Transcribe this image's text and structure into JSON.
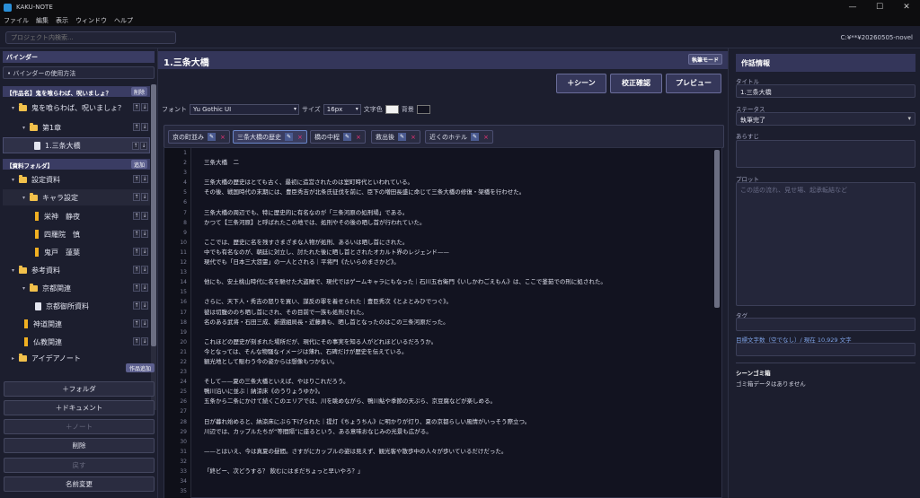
{
  "window": {
    "title": "KAKU-NOTE",
    "buttons": [
      "—",
      "☐",
      "✕"
    ]
  },
  "menu": [
    "ファイル",
    "編集",
    "表示",
    "ウィンドウ",
    "ヘルプ"
  ],
  "project_search": {
    "placeholder": "プロジェクト内検索..."
  },
  "project_path": "C:¥**¥20260505-novel",
  "binder": {
    "header": "バインダー",
    "usage": "• バインダーの使用方法",
    "works_section": {
      "title": "【作品名】鬼を喰らわば、呪いましょ？",
      "button": "削除"
    },
    "materials_section": {
      "title": "【資料フォルダ】",
      "button": "追加"
    },
    "rows": [
      {
        "text": "鬼を喰らわば、呪いましょ？"
      },
      {
        "text": "第1章"
      },
      {
        "text": "1.三条大橋"
      },
      {
        "text": "設定資料"
      },
      {
        "text": "キャラ設定"
      },
      {
        "text": "栄神　静夜"
      },
      {
        "text": "四羅院　慎"
      },
      {
        "text": "鬼戸　蓮葉"
      },
      {
        "text": "参考資料"
      },
      {
        "text": "京都関連"
      },
      {
        "text": "京都御所資料"
      },
      {
        "text": "神道関連"
      },
      {
        "text": "仏教関連"
      },
      {
        "text": "アイデアノート"
      }
    ],
    "add_work": "作品追加",
    "buttons": {
      "folder": "＋フォルダ",
      "document": "＋ドキュメント",
      "note": "＋ノート",
      "delete": "削除",
      "back": "戻す",
      "rename": "名前変更"
    }
  },
  "editor": {
    "title": "1.三条大橋",
    "mode_button": "執筆モード",
    "add_scene": "＋シーン",
    "proofread": "校正確認",
    "preview": "プレビュー",
    "font_label": "フォント",
    "font_value": "Yu Gothic UI",
    "size_label": "サイズ",
    "size_value": "16px",
    "text_color_label": "文字色",
    "bg_label": "背景",
    "tags": [
      "京の町並み",
      "三条大橋の歴史",
      "橋の中程",
      "救出後",
      "近くのホテル"
    ],
    "line_numbers": [
      "1",
      "2",
      "3",
      "4",
      "5",
      "6",
      "7",
      "8",
      "9",
      "10",
      "11",
      "12",
      "13",
      "14",
      "15",
      "16",
      "17",
      "18",
      "19",
      "20",
      "21",
      "22",
      "23",
      "24",
      "25",
      "26",
      "27",
      "28",
      "29",
      "30",
      "31",
      "32",
      "33",
      "34",
      "35"
    ],
    "lines": [
      "",
      "三条大橋　二",
      "",
      "三条大橋の歴史はとても古く、最初に造営されたのは室町時代といわれている。",
      "その後、戦国時代の末期には、豊臣秀吉が北条氏征伐を前に、臣下の増田長盛に命じて三条大橋の修復・架橋を行わせた。",
      "",
      "三条大橋の周辺でも、特に歴史的に有名なのが「三条河原の処刑場」である。",
      "かつて【三条河原】と呼ばれたこの地では、処刑やその後の晒し首が行われていた。",
      "",
      "ここでは、歴史に名を残すさまざまな人物が処刑、あるいは晒し首にされた。",
      "中でも有名なのが、朝廷に対立し、討たれた後に晒し首とされたオカルト界のレジェンド——",
      "現代でも「日本三大怨霊」の一人とされる｜平将門《たいらのまさかど》。",
      "",
      "他にも、安土桃山時代に名を馳せた大盗賊で、現代ではゲームキャラにもなった｜石川五右衛門《いしかわごえもん》は、ここで釜茹での刑に処された。",
      "",
      "さらに、天下人・秀吉の怒りを買い、謀反の罪を着せられた｜豊臣秀次《とよとみひでつぐ》。",
      "彼は切腹ののち晒し首にされ、その目前で一族も処刑された。",
      "名のある武将・石田三成、新選組局長・近藤勇も、晒し首となったのはこの三条河原だった。",
      "",
      "これほどの歴史が刻まれた場所だが、現代にその事実を知る人がどれほどいるだろうか。",
      "今となっては、そんな物騒なイメージは薄れ、石碑だけが歴史を伝えている。",
      "観光地として賑わう今の姿からは想像もつかない。",
      "",
      "そして——夏の三条大橋といえば、やはりこれだろう。",
      "鴨川沿いに並ぶ｜納涼床《のうりょうゆか》。",
      "五条から二条にかけて続くこのエリアでは、川を眺めながら、鴨川鮎や季節の天ぷら、京豆腐などが楽しめる。",
      "",
      "日が暮れ始めると、納涼床にぶら下げられた｜提灯《ちょうちん》に明かりが灯り、夏の京都らしい風情がいっそう際立つ。",
      "川辺では、カップルたちが“等間隔”に座るという、ある意味おなじみの光景も広がる。",
      "",
      "——とはいえ、今は真夏の昼間。さすがにカップルの姿は見えず、観光客や散歩中の人々が歩いているだけだった。",
      "",
      "「終ビー、次どうする？ 飲むにはまだちょっと早いやろ？」",
      "",
      ""
    ]
  },
  "info": {
    "header": "作話情報",
    "title_label": "タイトル",
    "title_value": "1.三条大橋",
    "status_label": "ステータス",
    "status_value": "執筆完了",
    "synopsis_label": "あらすじ",
    "plot_label": "プロット",
    "plot_placeholder": "この話の流れ、見せ場、起承転結など",
    "tag_label": "タグ",
    "target_label": "目標文字数（空でなし）/ 現在 10,929 文字",
    "trash_header": "シーンゴミ箱",
    "trash_empty": "ゴミ箱データはありません"
  }
}
